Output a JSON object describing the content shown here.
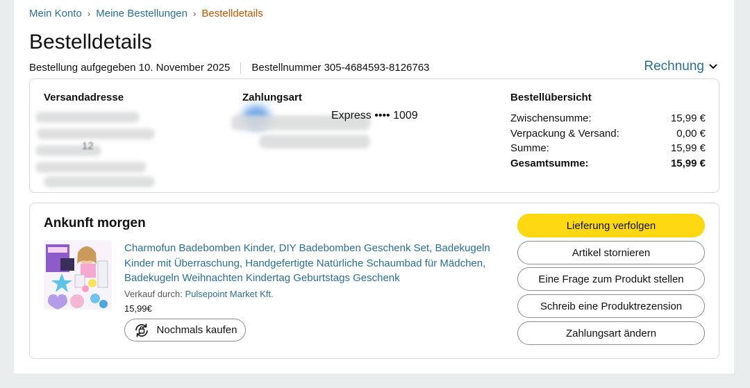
{
  "breadcrumb": {
    "items": [
      "Mein Konto",
      "Meine Bestellungen"
    ],
    "current": "Bestelldetails",
    "separator": "›"
  },
  "page_title": "Bestelldetails",
  "order": {
    "placed": "Bestellung aufgegeben 10. November 2025",
    "number": "Bestellnummer 305-4684593-8126763",
    "invoice_label": "Rechnung"
  },
  "shipping": {
    "heading": "Versandadresse",
    "visible_fragment": "12"
  },
  "payment": {
    "heading": "Zahlungsart",
    "card_text": "Express •••• 1009"
  },
  "summary": {
    "heading": "Bestellübersicht",
    "rows": [
      {
        "label": "Zwischensumme:",
        "value": "15,99 €"
      },
      {
        "label": "Verpackung & Versand:",
        "value": "0,00 €"
      },
      {
        "label": "Summe:",
        "value": "15,99 €"
      },
      {
        "label": "Gesamtsumme:",
        "value": "15,99 €"
      }
    ]
  },
  "delivery": {
    "status": "Ankunft morgen",
    "product": {
      "title": "Charmofun Badebomben Kinder, DIY Badebomben Geschenk Set, Badekugeln Kinder mit Überraschung, Handgefertigte Natürliche Schaumbad für Mädchen, Badekugeln Weihnachten Kindertag Geburtstags Geschenk",
      "seller_label": "Verkauf durch:",
      "seller_name": "Pulsepoint Market Kft.",
      "price": "15,99€",
      "rebuy_label": "Nochmals kaufen"
    }
  },
  "actions": {
    "track": "Lieferung verfolgen",
    "cancel": "Artikel stornieren",
    "question": "Eine Frage zum Produkt stellen",
    "review": "Schreib eine Produktrezension",
    "change_payment": "Zahlungsart ändern"
  },
  "colors": {
    "link": "#2a6f94",
    "breadcrumb_current": "#c45500",
    "primary_button": "#ffd814",
    "page_background": "#eaeded"
  },
  "icons": {
    "invoice": "chevron-down-icon",
    "rebuy": "reorder-bag-icon"
  }
}
